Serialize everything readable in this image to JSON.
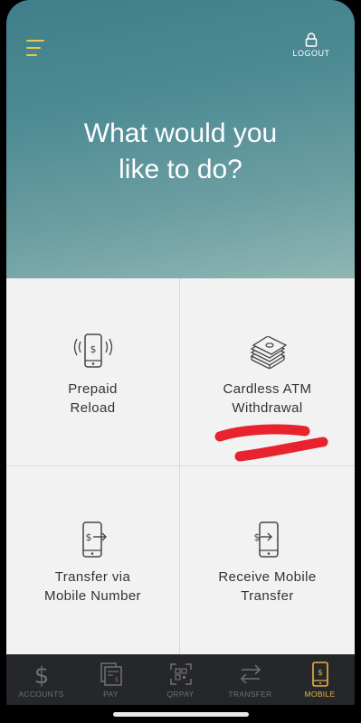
{
  "header": {
    "logout_label": "LOGOUT",
    "headline": "What would you\nlike to do?"
  },
  "tiles": [
    {
      "label": "Prepaid\nReload",
      "icon": "phone-dollar-signal-icon"
    },
    {
      "label": "Cardless ATM\nWithdrawal",
      "icon": "cash-stack-icon"
    },
    {
      "label": "Transfer via\nMobile Number",
      "icon": "phone-send-transfer-icon"
    },
    {
      "label": "Receive Mobile\nTransfer",
      "icon": "phone-receive-transfer-icon"
    }
  ],
  "tabbar": {
    "items": [
      {
        "label": "ACCOUNTS",
        "icon": "dollar-icon",
        "active": false
      },
      {
        "label": "PAY",
        "icon": "bill-icon",
        "active": false
      },
      {
        "label": "QRPAY",
        "icon": "qr-scan-icon",
        "active": false
      },
      {
        "label": "TRANSFER",
        "icon": "transfer-arrows-icon",
        "active": false
      },
      {
        "label": "MOBILE",
        "icon": "mobile-dollar-icon",
        "active": true
      }
    ]
  },
  "colors": {
    "accent": "#e3b63c",
    "tabbar_bg": "#26272b",
    "hero_top": "#3f7f89",
    "hero_bottom": "#8fb6b3",
    "tile_bg": "#f2f2f2",
    "scribble": "#e8232e"
  }
}
